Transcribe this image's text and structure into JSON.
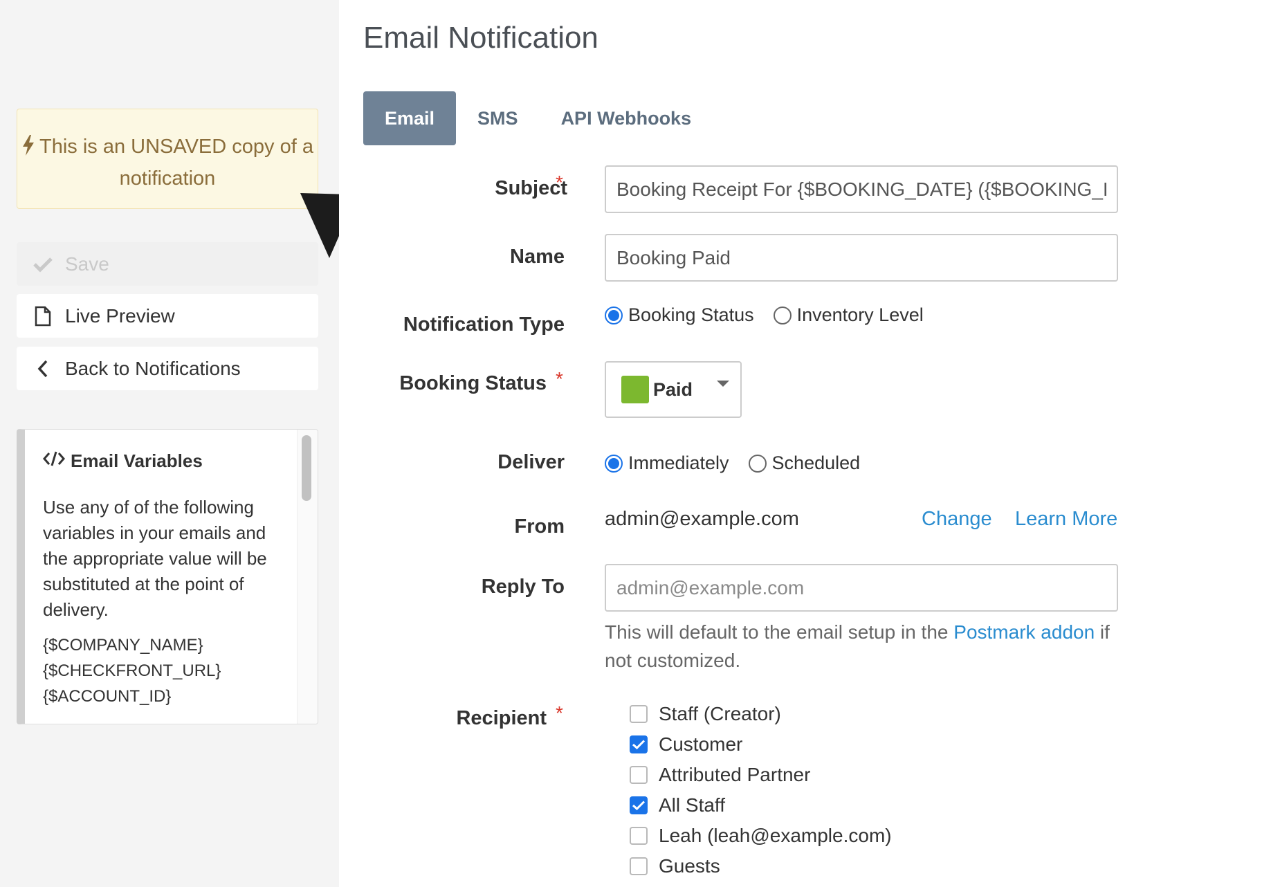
{
  "sidebar": {
    "unsaved_text": "This is an UNSAVED copy of a notification",
    "save_label": "Save",
    "live_preview_label": "Live Preview",
    "back_label": "Back to Notifications",
    "variables": {
      "title": "Email Variables",
      "description": "Use any of of the following variables in your emails and the appropriate value will be substituted at the point of delivery.",
      "items": [
        "{$COMPANY_NAME}",
        "{$CHECKFRONT_URL}",
        "{$ACCOUNT_ID}"
      ]
    }
  },
  "main": {
    "title": "Email Notification",
    "tabs": [
      {
        "label": "Email",
        "active": true
      },
      {
        "label": "SMS",
        "active": false
      },
      {
        "label": "API Webhooks",
        "active": false
      }
    ],
    "form": {
      "subject_label": "Subject",
      "subject_value": "Booking Receipt For {$BOOKING_DATE} ({$BOOKING_ID})",
      "name_label": "Name",
      "name_value": "Booking Paid",
      "notification_type_label": "Notification Type",
      "notification_type_options": [
        "Booking Status",
        "Inventory Level"
      ],
      "booking_status_label": "Booking Status",
      "booking_status_value": "Paid",
      "booking_status_color": "#7cb82f",
      "deliver_label": "Deliver",
      "deliver_options": [
        "Immediately",
        "Scheduled"
      ],
      "from_label": "From",
      "from_value": "admin@example.com",
      "change_link": "Change",
      "learn_more_link": "Learn More",
      "reply_to_label": "Reply To",
      "reply_to_placeholder": "admin@example.com",
      "reply_help_prefix": "This will default to the email setup in the ",
      "reply_help_link": "Postmark addon",
      "reply_help_suffix": " if not customized.",
      "recipient_label": "Recipient",
      "recipients": [
        {
          "label": "Staff (Creator)",
          "checked": false
        },
        {
          "label": "Customer",
          "checked": true
        },
        {
          "label": "Attributed Partner",
          "checked": false
        },
        {
          "label": "All Staff",
          "checked": true
        },
        {
          "label": "Leah (leah@example.com)",
          "checked": false
        },
        {
          "label": "Guests",
          "checked": false
        }
      ]
    }
  },
  "colors": {
    "accent": "#1a73e8",
    "link": "#2a8ccf",
    "tab_active": "#6f8296",
    "required": "#d9372b"
  }
}
